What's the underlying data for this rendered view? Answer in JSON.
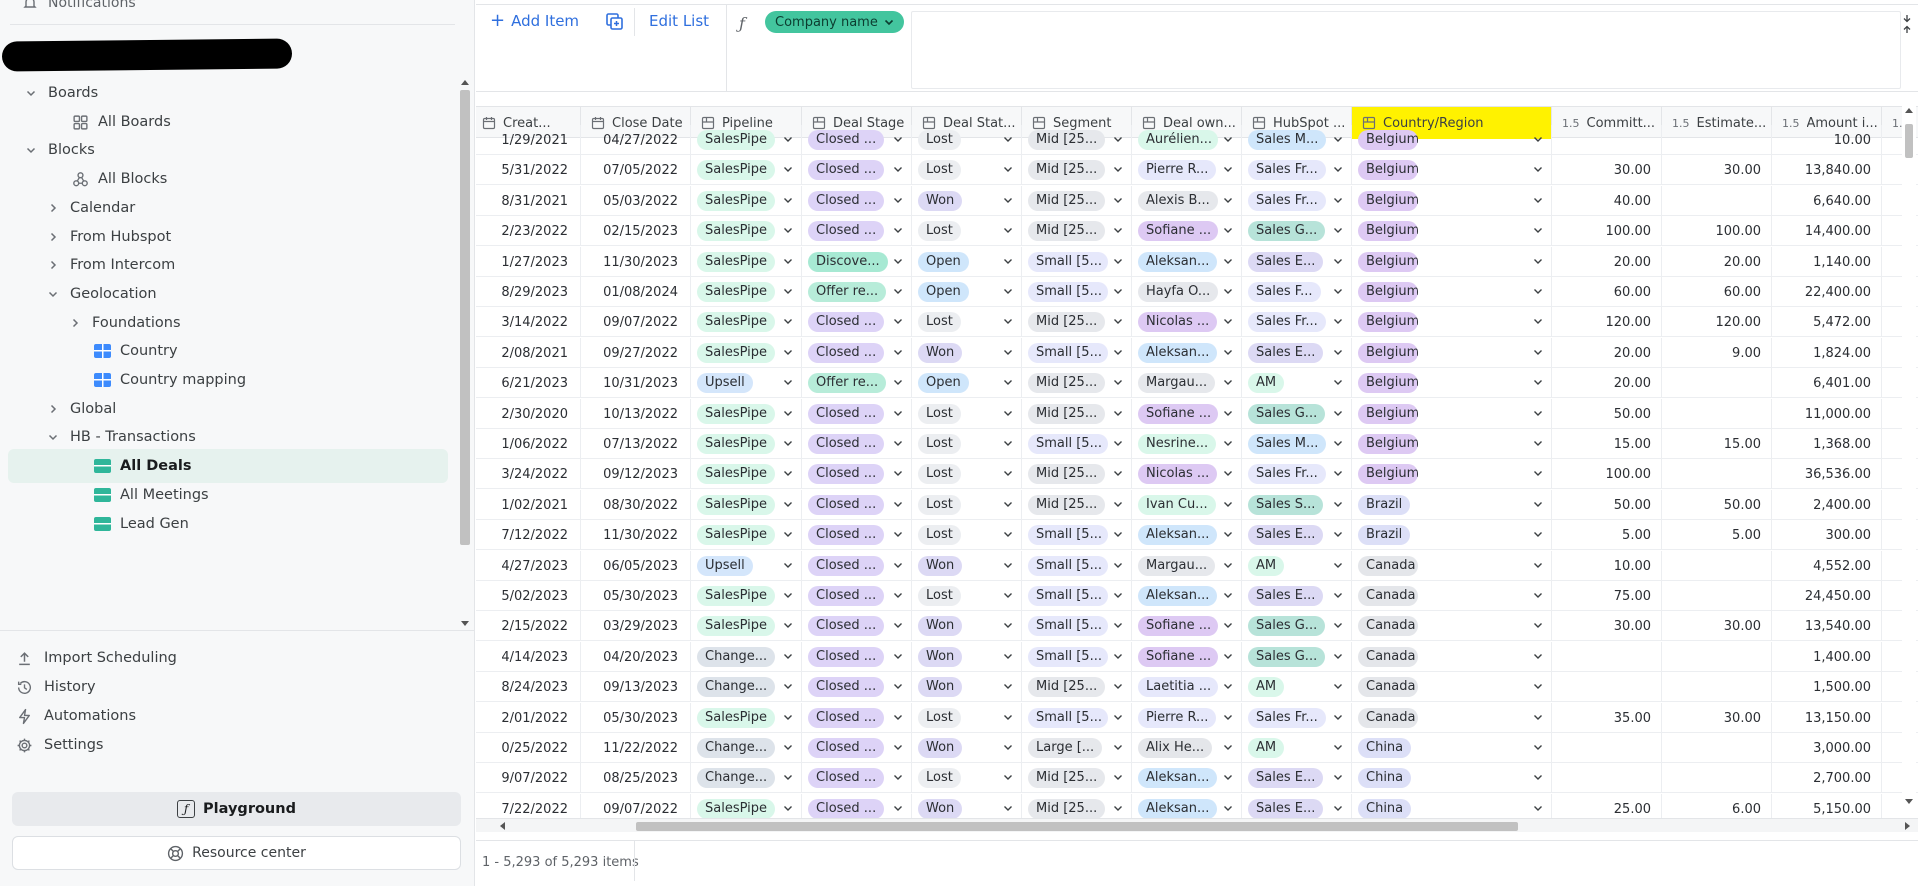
{
  "sidebar": {
    "notifications": "Notifications",
    "tree": [
      {
        "label": "Boards",
        "level": 0,
        "chevron": "down",
        "icon": "none",
        "name": "tree-boards"
      },
      {
        "label": "All Boards",
        "level": 1,
        "chevron": "none",
        "icon": "grid-icon",
        "name": "tree-all-boards"
      },
      {
        "label": "Blocks",
        "level": 0,
        "chevron": "down",
        "icon": "none",
        "name": "tree-blocks"
      },
      {
        "label": "All Blocks",
        "level": 1,
        "chevron": "none",
        "icon": "blocks-icon",
        "name": "tree-all-blocks"
      },
      {
        "label": "Calendar",
        "level": 1,
        "chevron": "right",
        "icon": "none",
        "name": "tree-calendar"
      },
      {
        "label": "From Hubspot",
        "level": 1,
        "chevron": "right",
        "icon": "none",
        "name": "tree-from-hubspot"
      },
      {
        "label": "From Intercom",
        "level": 1,
        "chevron": "right",
        "icon": "none",
        "name": "tree-from-intercom"
      },
      {
        "label": "Geolocation",
        "level": 1,
        "chevron": "down",
        "icon": "none",
        "name": "tree-geolocation"
      },
      {
        "label": "Foundations",
        "level": 2,
        "chevron": "right",
        "icon": "none",
        "name": "tree-foundations"
      },
      {
        "label": "Country",
        "level": 2,
        "chevron": "none",
        "icon": "table-blue-icon",
        "name": "tree-country"
      },
      {
        "label": "Country mapping",
        "level": 2,
        "chevron": "none",
        "icon": "table-blue-icon",
        "name": "tree-country-mapping"
      },
      {
        "label": "Global",
        "level": 1,
        "chevron": "right",
        "icon": "none",
        "name": "tree-global"
      },
      {
        "label": "HB - Transactions",
        "level": 1,
        "chevron": "down",
        "icon": "none",
        "name": "tree-hb-transactions"
      },
      {
        "label": "All Deals",
        "level": 2,
        "chevron": "none",
        "icon": "table-green-icon",
        "name": "tree-all-deals",
        "selected": true
      },
      {
        "label": "All Meetings",
        "level": 2,
        "chevron": "none",
        "icon": "table-green-icon",
        "name": "tree-all-meetings"
      },
      {
        "label": "Lead Gen",
        "level": 2,
        "chevron": "none",
        "icon": "table-green-icon",
        "name": "tree-lead-gen"
      }
    ],
    "bottom_nav": [
      {
        "label": "Import Scheduling",
        "icon": "upload-icon",
        "name": "nav-import-scheduling"
      },
      {
        "label": "History",
        "icon": "history-icon",
        "name": "nav-history"
      },
      {
        "label": "Automations",
        "icon": "bolt-icon",
        "name": "nav-automations"
      },
      {
        "label": "Settings",
        "icon": "gear-icon",
        "name": "nav-settings"
      }
    ],
    "playground": "Playground",
    "resource_center": "Resource center"
  },
  "toolbar": {
    "add_item": "Add Item",
    "edit_list": "Edit List",
    "formula_symbol": "ƒ",
    "company_chip": "Company name"
  },
  "grid": {
    "columns": [
      {
        "label": "Creat...",
        "type": "date",
        "icon": "calendar-icon"
      },
      {
        "label": "Close Date",
        "type": "date",
        "icon": "calendar-icon"
      },
      {
        "label": "Pipeline",
        "type": "select",
        "icon": "select-icon"
      },
      {
        "label": "Deal Stage",
        "type": "select",
        "icon": "select-icon"
      },
      {
        "label": "Deal Stat...",
        "type": "select",
        "icon": "select-icon"
      },
      {
        "label": "Segment",
        "type": "select",
        "icon": "select-icon"
      },
      {
        "label": "Deal own...",
        "type": "select",
        "icon": "select-icon"
      },
      {
        "label": "HubSpot ...",
        "type": "select",
        "icon": "select-icon"
      },
      {
        "label": "Country/Region",
        "type": "select",
        "icon": "select-icon",
        "highlight": true
      },
      {
        "label": "Committ...",
        "type": "number",
        "icon": "1.5"
      },
      {
        "label": "Estimate...",
        "type": "number",
        "icon": "1.5"
      },
      {
        "label": "Amount i...",
        "type": "number",
        "icon": "1.5"
      },
      {
        "label": "",
        "type": "number",
        "icon": "1.5"
      }
    ],
    "chip_colors": {
      "SalesPipe": "#d9f7ea",
      "Upsell": "#d4e6fb",
      "Change...": "#dde3ea",
      "Closed ...": "#ddd3f7",
      "Discove...": "#a7e9d3",
      "Offer re...": "#b7ecd9",
      "Lost": "#eceef1",
      "Won": "#dcd9f4",
      "Open": "#cfe6fb",
      "Mid [25...": "#e6e8ec",
      "Small [5...": "#e6e8fb",
      "Large [...": "#e6e8ec",
      "Belgium": "#ddc9f3",
      "Brazil": "#dcdff7",
      "Canada": "#e4e6ea",
      "China": "#dcdff7"
    },
    "rows": [
      [
        "1/29/2021",
        "04/27/2022",
        "SalesPipe",
        "Closed ...",
        "Lost",
        "Mid [25...",
        "Aurélien...",
        "Sales M...",
        "Belgium",
        "",
        "",
        "10.00"
      ],
      [
        "5/31/2022",
        "07/05/2022",
        "SalesPipe",
        "Closed ...",
        "Lost",
        "Mid [25...",
        "Pierre R...",
        "Sales Fr...",
        "Belgium",
        "30.00",
        "30.00",
        "13,840.00"
      ],
      [
        "8/31/2021",
        "05/03/2022",
        "SalesPipe",
        "Closed ...",
        "Won",
        "Mid [25...",
        "Alexis B...",
        "Sales Fr...",
        "Belgium",
        "40.00",
        "",
        "6,640.00"
      ],
      [
        "2/23/2022",
        "02/15/2023",
        "SalesPipe",
        "Closed ...",
        "Lost",
        "Mid [25...",
        "Sofiane ...",
        "Sales G...",
        "Belgium",
        "100.00",
        "100.00",
        "14,400.00"
      ],
      [
        "1/27/2023",
        "11/30/2023",
        "SalesPipe",
        "Discove...",
        "Open",
        "Small [5...",
        "Aleksan...",
        "Sales E...",
        "Belgium",
        "20.00",
        "20.00",
        "1,140.00"
      ],
      [
        "8/29/2023",
        "01/08/2024",
        "SalesPipe",
        "Offer re...",
        "Open",
        "Small [5...",
        "Hayfa O...",
        "Sales F...",
        "Belgium",
        "60.00",
        "60.00",
        "22,400.00"
      ],
      [
        "3/14/2022",
        "09/07/2022",
        "SalesPipe",
        "Closed ...",
        "Lost",
        "Mid [25...",
        "Nicolas ...",
        "Sales Fr...",
        "Belgium",
        "120.00",
        "120.00",
        "5,472.00"
      ],
      [
        "2/08/2021",
        "09/27/2022",
        "SalesPipe",
        "Closed ...",
        "Won",
        "Small [5...",
        "Aleksan...",
        "Sales E...",
        "Belgium",
        "20.00",
        "9.00",
        "1,824.00"
      ],
      [
        "6/21/2023",
        "10/31/2023",
        "Upsell",
        "Offer re...",
        "Open",
        "Mid [25...",
        "Margau...",
        "AM",
        "Belgium",
        "20.00",
        "",
        "6,401.00"
      ],
      [
        "2/30/2020",
        "10/13/2022",
        "SalesPipe",
        "Closed ...",
        "Lost",
        "Mid [25...",
        "Sofiane ...",
        "Sales G...",
        "Belgium",
        "50.00",
        "",
        "11,000.00"
      ],
      [
        "1/06/2022",
        "07/13/2022",
        "SalesPipe",
        "Closed ...",
        "Lost",
        "Small [5...",
        "Nesrine...",
        "Sales M...",
        "Belgium",
        "15.00",
        "15.00",
        "1,368.00"
      ],
      [
        "3/24/2022",
        "09/12/2023",
        "SalesPipe",
        "Closed ...",
        "Lost",
        "Mid [25...",
        "Nicolas ...",
        "Sales Fr...",
        "Belgium",
        "100.00",
        "",
        "36,536.00"
      ],
      [
        "1/02/2021",
        "08/30/2022",
        "SalesPipe",
        "Closed ...",
        "Lost",
        "Mid [25...",
        "Ivan Cu...",
        "Sales S...",
        "Brazil",
        "50.00",
        "50.00",
        "2,400.00"
      ],
      [
        "7/12/2022",
        "11/30/2022",
        "SalesPipe",
        "Closed ...",
        "Lost",
        "Small [5...",
        "Aleksan...",
        "Sales E...",
        "Brazil",
        "5.00",
        "5.00",
        "300.00"
      ],
      [
        "4/27/2023",
        "06/05/2023",
        "Upsell",
        "Closed ...",
        "Won",
        "Small [5...",
        "Margau...",
        "AM",
        "Canada",
        "10.00",
        "",
        "4,552.00"
      ],
      [
        "5/02/2023",
        "05/30/2023",
        "SalesPipe",
        "Closed ...",
        "Lost",
        "Small [5...",
        "Aleksan...",
        "Sales E...",
        "Canada",
        "75.00",
        "",
        "24,450.00"
      ],
      [
        "2/15/2022",
        "03/29/2023",
        "SalesPipe",
        "Closed ...",
        "Won",
        "Small [5...",
        "Sofiane ...",
        "Sales G...",
        "Canada",
        "30.00",
        "30.00",
        "13,540.00"
      ],
      [
        "4/14/2023",
        "04/20/2023",
        "Change...",
        "Closed ...",
        "Won",
        "Small [5...",
        "Sofiane ...",
        "Sales G...",
        "Canada",
        "",
        "",
        "1,400.00"
      ],
      [
        "8/24/2023",
        "09/13/2023",
        "Change...",
        "Closed ...",
        "Won",
        "Mid [25...",
        "Laetitia ...",
        "AM",
        "Canada",
        "",
        "",
        "1,500.00"
      ],
      [
        "2/01/2022",
        "05/30/2023",
        "SalesPipe",
        "Closed ...",
        "Lost",
        "Small [5...",
        "Pierre R...",
        "Sales Fr...",
        "Canada",
        "35.00",
        "30.00",
        "13,150.00"
      ],
      [
        "0/25/2022",
        "11/22/2022",
        "Change...",
        "Closed ...",
        "Won",
        "Large [...",
        "Alix He...",
        "AM",
        "China",
        "",
        "",
        "3,000.00"
      ],
      [
        "9/07/2022",
        "08/25/2023",
        "Change...",
        "Closed ...",
        "Lost",
        "Mid [25...",
        "Aleksan...",
        "Sales E...",
        "China",
        "",
        "",
        "2,700.00"
      ],
      [
        "7/22/2022",
        "09/07/2022",
        "SalesPipe",
        "Closed ...",
        "Won",
        "Mid [25...",
        "Aleksan...",
        "Sales E...",
        "China",
        "25.00",
        "6.00",
        "5,150.00"
      ]
    ],
    "owner_colors": {
      "Aurélien...": "#d9f7ea",
      "Pierre R...": "#e6e8fb",
      "Alexis B...": "#e6e8ec",
      "Sofiane ...": "#ddc9f3",
      "Aleksan...": "#cfe6fb",
      "Hayfa O...": "#e6e8ec",
      "Nicolas ...": "#ddc9f3",
      "Margau...": "#e6e8ec",
      "Nesrine...": "#d9f7ea",
      "Ivan Cu...": "#d9f7ea",
      "Laetitia ...": "#e6e8fb",
      "Alix He...": "#e4e6ea"
    },
    "team_colors": {
      "Sales M...": "#cfe6fb",
      "Sales Fr...": "#e6e8fb",
      "Sales G...": "#b7e3d9",
      "Sales E...": "#dcd9f4",
      "Sales F...": "#e6e8fb",
      "AM": "#d9f7ea",
      "Sales S...": "#b7e3d9"
    }
  },
  "footer": {
    "count": "1 - 5,293 of 5,293 items"
  }
}
